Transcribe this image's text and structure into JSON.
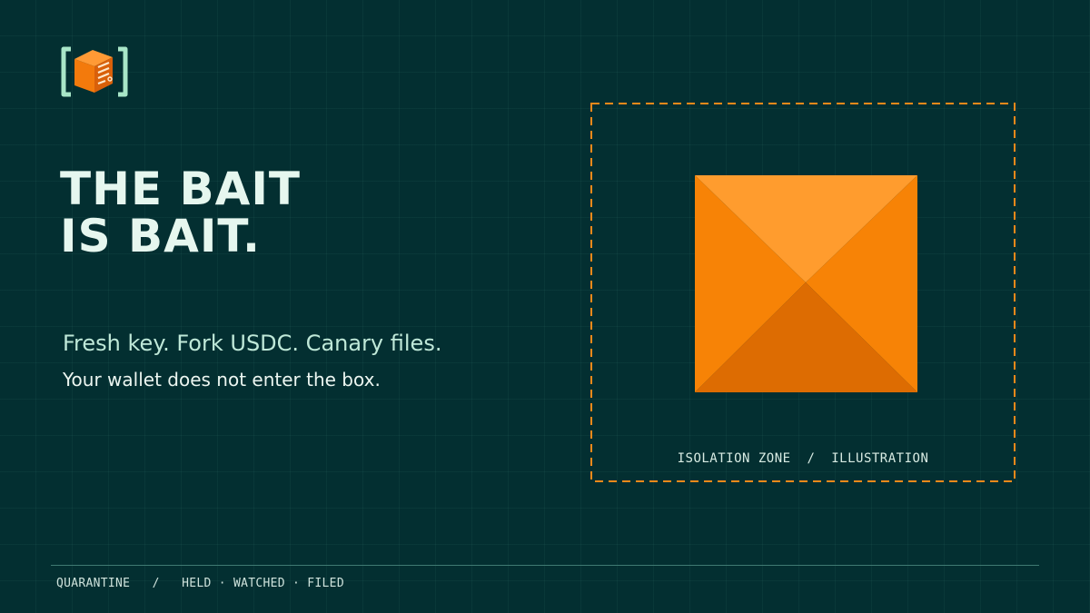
{
  "logo": {
    "icon": "quarantine-box-icon",
    "colors": {
      "bracket": "#a8e6c8",
      "box_front": "#f37a0c",
      "box_top": "#ff9a35",
      "box_side": "#d9600a",
      "label": "#fde8cc"
    }
  },
  "headline": {
    "line1": "THE BAIT",
    "line2": "IS BAIT."
  },
  "tagline": "Fresh key. Fork USDC. Canary files.",
  "subline": "Your wallet does not enter the box.",
  "isolation": {
    "caption": "ISOLATION ZONE  /  ILLUSTRATION",
    "border_color": "#f5891a",
    "cube_colors": {
      "top": "#ff9c2e",
      "left": "#f78306",
      "right": "#f78306",
      "bottom": "#dd6c02"
    }
  },
  "footer": {
    "text": "QUARANTINE   /   HELD · WATCHED · FILED"
  },
  "colors": {
    "background": "#032f31",
    "headline": "#e6f7ef",
    "accent": "#f5891a"
  }
}
